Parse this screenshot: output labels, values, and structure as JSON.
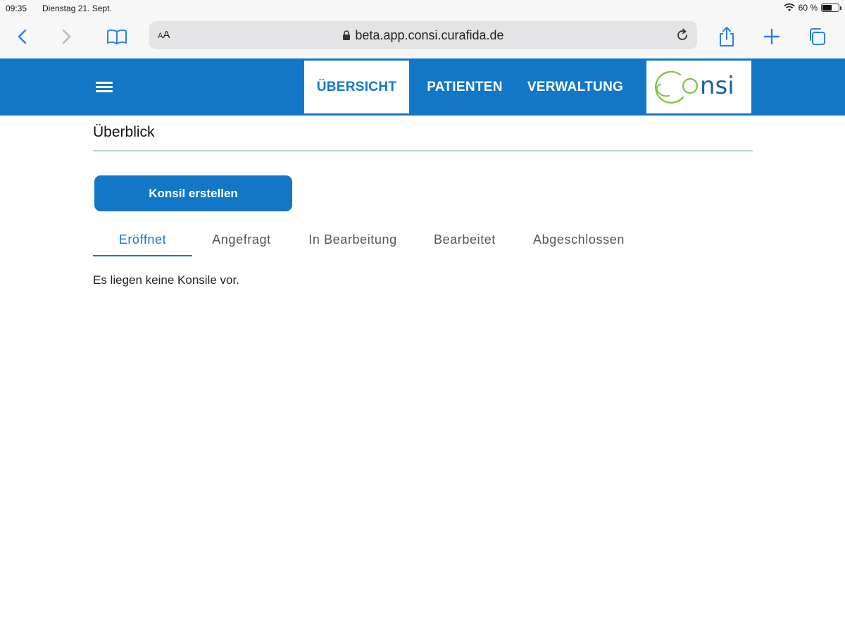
{
  "status_bar": {
    "time": "09:35",
    "date": "Dienstag 21. Sept.",
    "battery": "60 %",
    "battery_level": 0.6
  },
  "browser": {
    "text_size_label_small": "A",
    "text_size_label_large": "A",
    "url": "beta.app.consi.curafida.de",
    "icons": [
      "back-icon",
      "forward-icon",
      "bookmarks-icon",
      "lock-icon",
      "reload-icon",
      "share-icon",
      "new-tab-icon",
      "tabs-icon"
    ]
  },
  "app": {
    "nav": {
      "items": [
        {
          "label": "ÜBERSICHT",
          "active": true
        },
        {
          "label": "PATIENTEN",
          "active": false
        },
        {
          "label": "VERWALTUNG",
          "active": false
        }
      ]
    },
    "logo": {
      "text": "Consi",
      "colors": {
        "ring": "#7dc242",
        "text": "#1d5fa5"
      }
    }
  },
  "page": {
    "title": "Überblick",
    "create_button": "Konsil erstellen",
    "tabs": [
      {
        "label": "Eröffnet",
        "active": true
      },
      {
        "label": "Angefragt",
        "active": false
      },
      {
        "label": "In Bearbeitung",
        "active": false
      },
      {
        "label": "Bearbeitet",
        "active": false
      },
      {
        "label": "Abgeschlossen",
        "active": false
      }
    ],
    "empty_message": "Es liegen keine Konsile vor."
  },
  "colors": {
    "primary": "#1377c8",
    "browser_chrome": "#f7f7f7",
    "ios_blue": "#2a82e4"
  }
}
